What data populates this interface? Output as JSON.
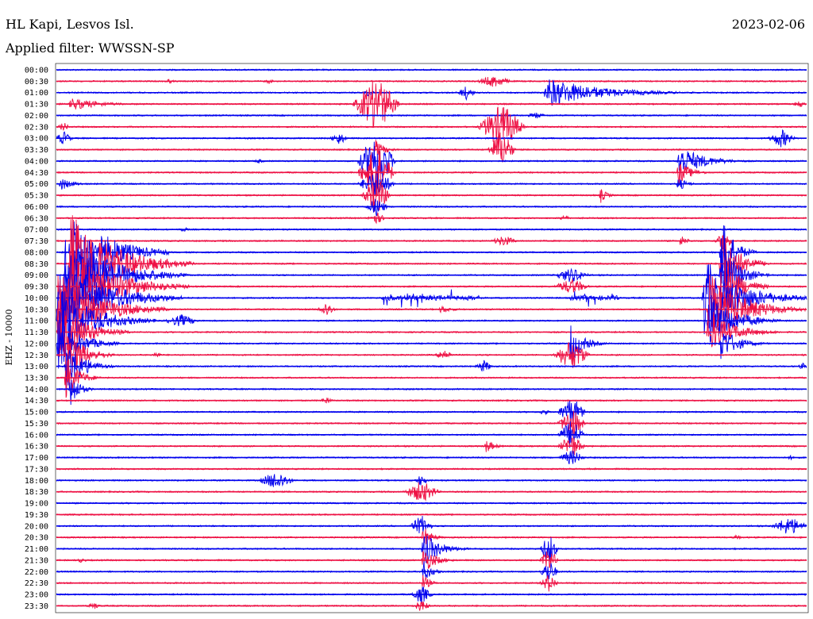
{
  "header": {
    "station": "HL Kapi, Lesvos Isl.",
    "date": "2023-02-06",
    "filter": "Applied filter: WWSSN-SP"
  },
  "chart_data": {
    "type": "line",
    "subtype": "helicorder",
    "channel_label": "EHZ - 10000",
    "row_labels": [
      "00:00",
      "00:30",
      "01:00",
      "01:30",
      "02:00",
      "02:30",
      "03:00",
      "03:30",
      "04:00",
      "04:30",
      "05:00",
      "05:30",
      "06:00",
      "06:30",
      "07:00",
      "07:30",
      "08:00",
      "08:30",
      "09:00",
      "09:30",
      "10:00",
      "10:30",
      "11:00",
      "11:30",
      "12:00",
      "12:30",
      "13:00",
      "13:30",
      "14:00",
      "14:30",
      "15:00",
      "15:30",
      "16:00",
      "16:30",
      "17:00",
      "17:30",
      "18:00",
      "18:30",
      "19:00",
      "19:30",
      "20:00",
      "20:30",
      "21:00",
      "21:30",
      "22:00",
      "22:30",
      "23:00",
      "23:30"
    ],
    "row_minutes": 30,
    "colors": [
      "#0000ee",
      "#ee1144"
    ],
    "grid": false,
    "events": [
      {
        "row": 1,
        "minute": 17.5,
        "amp": 8,
        "dur": 0.8,
        "kind": "spike"
      },
      {
        "row": 1,
        "minute": 4.5,
        "amp": 3,
        "dur": 0.3,
        "kind": "spike"
      },
      {
        "row": 1,
        "minute": 8.5,
        "amp": 3,
        "dur": 0.3,
        "kind": "spike"
      },
      {
        "row": 2,
        "minute": 19.5,
        "amp": 20,
        "dur": 6.5,
        "kind": "quake"
      },
      {
        "row": 2,
        "minute": 16.4,
        "amp": 9,
        "dur": 0.4,
        "kind": "spike"
      },
      {
        "row": 2,
        "minute": 12.5,
        "amp": 5,
        "dur": 0.3,
        "kind": "spike"
      },
      {
        "row": 3,
        "minute": 0.5,
        "amp": 9,
        "dur": 3.5,
        "kind": "quake"
      },
      {
        "row": 3,
        "minute": 29.7,
        "amp": 5,
        "dur": 0.3,
        "kind": "spike"
      },
      {
        "row": 3,
        "minute": 12.8,
        "amp": 35,
        "dur": 1.0,
        "kind": "spike"
      },
      {
        "row": 4,
        "minute": 19.2,
        "amp": 4,
        "dur": 0.5,
        "kind": "spike"
      },
      {
        "row": 5,
        "minute": 17.8,
        "amp": 30,
        "dur": 1.0,
        "kind": "spike"
      },
      {
        "row": 5,
        "minute": 0.3,
        "amp": 6,
        "dur": 0.3,
        "kind": "spike"
      },
      {
        "row": 6,
        "minute": 0.3,
        "amp": 9,
        "dur": 0.4,
        "kind": "spike"
      },
      {
        "row": 6,
        "minute": 11.3,
        "amp": 8,
        "dur": 0.4,
        "kind": "spike"
      },
      {
        "row": 6,
        "minute": 29.0,
        "amp": 12,
        "dur": 0.6,
        "kind": "spike"
      },
      {
        "row": 7,
        "minute": 12.7,
        "amp": 14,
        "dur": 1.2,
        "kind": "quake"
      },
      {
        "row": 7,
        "minute": 17.8,
        "amp": 25,
        "dur": 0.6,
        "kind": "spike"
      },
      {
        "row": 8,
        "minute": 24.8,
        "amp": 22,
        "dur": 3.0,
        "kind": "quake"
      },
      {
        "row": 8,
        "minute": 12.8,
        "amp": 40,
        "dur": 0.8,
        "kind": "spike"
      },
      {
        "row": 8,
        "minute": 8.1,
        "amp": 3,
        "dur": 0.3,
        "kind": "spike"
      },
      {
        "row": 9,
        "minute": 24.8,
        "amp": 18,
        "dur": 1.5,
        "kind": "quake"
      },
      {
        "row": 9,
        "minute": 12.8,
        "amp": 35,
        "dur": 0.8,
        "kind": "spike"
      },
      {
        "row": 10,
        "minute": 0.1,
        "amp": 10,
        "dur": 1.5,
        "kind": "quake"
      },
      {
        "row": 10,
        "minute": 24.8,
        "amp": 12,
        "dur": 1.0,
        "kind": "quake"
      },
      {
        "row": 10,
        "minute": 12.8,
        "amp": 18,
        "dur": 0.8,
        "kind": "spike"
      },
      {
        "row": 11,
        "minute": 12.8,
        "amp": 25,
        "dur": 0.6,
        "kind": "spike"
      },
      {
        "row": 11,
        "minute": 21.7,
        "amp": 12,
        "dur": 0.8,
        "kind": "quake"
      },
      {
        "row": 12,
        "minute": 12.8,
        "amp": 12,
        "dur": 0.5,
        "kind": "spike"
      },
      {
        "row": 13,
        "minute": 12.8,
        "amp": 8,
        "dur": 0.4,
        "kind": "spike"
      },
      {
        "row": 13,
        "minute": 20.3,
        "amp": 4,
        "dur": 0.3,
        "kind": "spike"
      },
      {
        "row": 14,
        "minute": 5.1,
        "amp": 3,
        "dur": 0.3,
        "kind": "spike"
      },
      {
        "row": 15,
        "minute": 17.9,
        "amp": 7,
        "dur": 0.6,
        "kind": "spike"
      },
      {
        "row": 15,
        "minute": 24.9,
        "amp": 10,
        "dur": 0.8,
        "kind": "quake"
      },
      {
        "row": 15,
        "minute": 26.7,
        "amp": 12,
        "dur": 0.4,
        "kind": "spike"
      },
      {
        "row": 16,
        "minute": 0.5,
        "amp": 70,
        "dur": 4.0,
        "kind": "quake"
      },
      {
        "row": 16,
        "minute": 26.5,
        "amp": 55,
        "dur": 1.5,
        "kind": "quake"
      },
      {
        "row": 17,
        "minute": 0.5,
        "amp": 70,
        "dur": 5.0,
        "kind": "quake"
      },
      {
        "row": 17,
        "minute": 26.5,
        "amp": 55,
        "dur": 2.0,
        "kind": "quake"
      },
      {
        "row": 18,
        "minute": 0.3,
        "amp": 60,
        "dur": 5.0,
        "kind": "quake"
      },
      {
        "row": 18,
        "minute": 20.6,
        "amp": 10,
        "dur": 0.8,
        "kind": "spike"
      },
      {
        "row": 18,
        "minute": 26.5,
        "amp": 50,
        "dur": 2.0,
        "kind": "quake"
      },
      {
        "row": 19,
        "minute": 0.3,
        "amp": 60,
        "dur": 5.0,
        "kind": "quake"
      },
      {
        "row": 19,
        "minute": 20.6,
        "amp": 10,
        "dur": 0.8,
        "kind": "spike"
      },
      {
        "row": 19,
        "minute": 26.5,
        "amp": 55,
        "dur": 2.0,
        "kind": "quake"
      },
      {
        "row": 20,
        "minute": 0.1,
        "amp": 60,
        "dur": 5.0,
        "kind": "quake"
      },
      {
        "row": 20,
        "minute": 13.0,
        "amp": 12,
        "dur": 4.0,
        "kind": "burst"
      },
      {
        "row": 20,
        "minute": 20.5,
        "amp": 12,
        "dur": 2.0,
        "kind": "burst"
      },
      {
        "row": 20,
        "minute": 25.8,
        "amp": 55,
        "dur": 4.2,
        "kind": "quake"
      },
      {
        "row": 21,
        "minute": 0.0,
        "amp": 55,
        "dur": 4.5,
        "kind": "quake"
      },
      {
        "row": 21,
        "minute": 10.8,
        "amp": 10,
        "dur": 0.4,
        "kind": "spike"
      },
      {
        "row": 21,
        "minute": 15.3,
        "amp": 6,
        "dur": 1.5,
        "kind": "quake"
      },
      {
        "row": 21,
        "minute": 26.0,
        "amp": 50,
        "dur": 4.0,
        "kind": "quake"
      },
      {
        "row": 22,
        "minute": 0.0,
        "amp": 50,
        "dur": 4.0,
        "kind": "quake"
      },
      {
        "row": 22,
        "minute": 5.0,
        "amp": 8,
        "dur": 0.8,
        "kind": "spike"
      },
      {
        "row": 22,
        "minute": 26.0,
        "amp": 40,
        "dur": 3.0,
        "kind": "quake"
      },
      {
        "row": 23,
        "minute": 0.0,
        "amp": 45,
        "dur": 3.0,
        "kind": "quake"
      },
      {
        "row": 23,
        "minute": 26.0,
        "amp": 30,
        "dur": 3.0,
        "kind": "quake"
      },
      {
        "row": 24,
        "minute": 0.0,
        "amp": 40,
        "dur": 2.5,
        "kind": "quake"
      },
      {
        "row": 24,
        "minute": 20.5,
        "amp": 30,
        "dur": 1.5,
        "kind": "quake"
      },
      {
        "row": 24,
        "minute": 26.5,
        "amp": 25,
        "dur": 2.0,
        "kind": "quake"
      },
      {
        "row": 25,
        "minute": 0.3,
        "amp": 45,
        "dur": 2.0,
        "kind": "quake"
      },
      {
        "row": 25,
        "minute": 4.0,
        "amp": 4,
        "dur": 0.3,
        "kind": "spike"
      },
      {
        "row": 25,
        "minute": 15.5,
        "amp": 8,
        "dur": 0.4,
        "kind": "spike"
      },
      {
        "row": 25,
        "minute": 20.6,
        "amp": 20,
        "dur": 0.8,
        "kind": "spike"
      },
      {
        "row": 26,
        "minute": 0.3,
        "amp": 40,
        "dur": 2.0,
        "kind": "quake"
      },
      {
        "row": 26,
        "minute": 17.1,
        "amp": 8,
        "dur": 0.4,
        "kind": "spike"
      },
      {
        "row": 26,
        "minute": 29.9,
        "amp": 5,
        "dur": 0.3,
        "kind": "spike"
      },
      {
        "row": 27,
        "minute": 0.3,
        "amp": 35,
        "dur": 1.5,
        "kind": "quake"
      },
      {
        "row": 28,
        "minute": 0.5,
        "amp": 30,
        "dur": 1.0,
        "kind": "quake"
      },
      {
        "row": 29,
        "minute": 10.8,
        "amp": 5,
        "dur": 0.3,
        "kind": "spike"
      },
      {
        "row": 30,
        "minute": 19.5,
        "amp": 4,
        "dur": 0.3,
        "kind": "spike"
      },
      {
        "row": 30,
        "minute": 20.6,
        "amp": 20,
        "dur": 0.6,
        "kind": "spike"
      },
      {
        "row": 31,
        "minute": 20.6,
        "amp": 20,
        "dur": 0.6,
        "kind": "spike"
      },
      {
        "row": 32,
        "minute": 20.6,
        "amp": 20,
        "dur": 0.6,
        "kind": "spike"
      },
      {
        "row": 33,
        "minute": 17.1,
        "amp": 12,
        "dur": 1.0,
        "kind": "quake"
      },
      {
        "row": 33,
        "minute": 20.6,
        "amp": 15,
        "dur": 0.6,
        "kind": "spike"
      },
      {
        "row": 34,
        "minute": 20.6,
        "amp": 10,
        "dur": 0.6,
        "kind": "spike"
      },
      {
        "row": 34,
        "minute": 29.4,
        "amp": 3,
        "dur": 0.3,
        "kind": "spike"
      },
      {
        "row": 36,
        "minute": 8.8,
        "amp": 12,
        "dur": 0.8,
        "kind": "spike"
      },
      {
        "row": 36,
        "minute": 14.6,
        "amp": 8,
        "dur": 0.3,
        "kind": "spike"
      },
      {
        "row": 37,
        "minute": 14.6,
        "amp": 14,
        "dur": 0.8,
        "kind": "spike"
      },
      {
        "row": 40,
        "minute": 14.6,
        "amp": 14,
        "dur": 0.5,
        "kind": "spike"
      },
      {
        "row": 40,
        "minute": 29.3,
        "amp": 12,
        "dur": 0.8,
        "kind": "spike"
      },
      {
        "row": 41,
        "minute": 14.6,
        "amp": 18,
        "dur": 1.0,
        "kind": "quake"
      },
      {
        "row": 41,
        "minute": 27.2,
        "amp": 3,
        "dur": 0.3,
        "kind": "spike"
      },
      {
        "row": 42,
        "minute": 14.6,
        "amp": 25,
        "dur": 2.0,
        "kind": "quake"
      },
      {
        "row": 42,
        "minute": 19.7,
        "amp": 20,
        "dur": 0.4,
        "kind": "spike"
      },
      {
        "row": 43,
        "minute": 14.6,
        "amp": 20,
        "dur": 1.5,
        "kind": "quake"
      },
      {
        "row": 43,
        "minute": 19.7,
        "amp": 15,
        "dur": 0.4,
        "kind": "spike"
      },
      {
        "row": 43,
        "minute": 1.0,
        "amp": 3,
        "dur": 0.3,
        "kind": "spike"
      },
      {
        "row": 44,
        "minute": 14.6,
        "amp": 18,
        "dur": 1.0,
        "kind": "quake"
      },
      {
        "row": 44,
        "minute": 19.7,
        "amp": 15,
        "dur": 0.4,
        "kind": "spike"
      },
      {
        "row": 45,
        "minute": 14.6,
        "amp": 15,
        "dur": 0.8,
        "kind": "quake"
      },
      {
        "row": 45,
        "minute": 19.7,
        "amp": 12,
        "dur": 0.4,
        "kind": "spike"
      },
      {
        "row": 46,
        "minute": 14.6,
        "amp": 12,
        "dur": 0.5,
        "kind": "spike"
      },
      {
        "row": 47,
        "minute": 1.5,
        "amp": 5,
        "dur": 0.3,
        "kind": "spike"
      },
      {
        "row": 47,
        "minute": 14.6,
        "amp": 8,
        "dur": 0.4,
        "kind": "spike"
      }
    ]
  }
}
